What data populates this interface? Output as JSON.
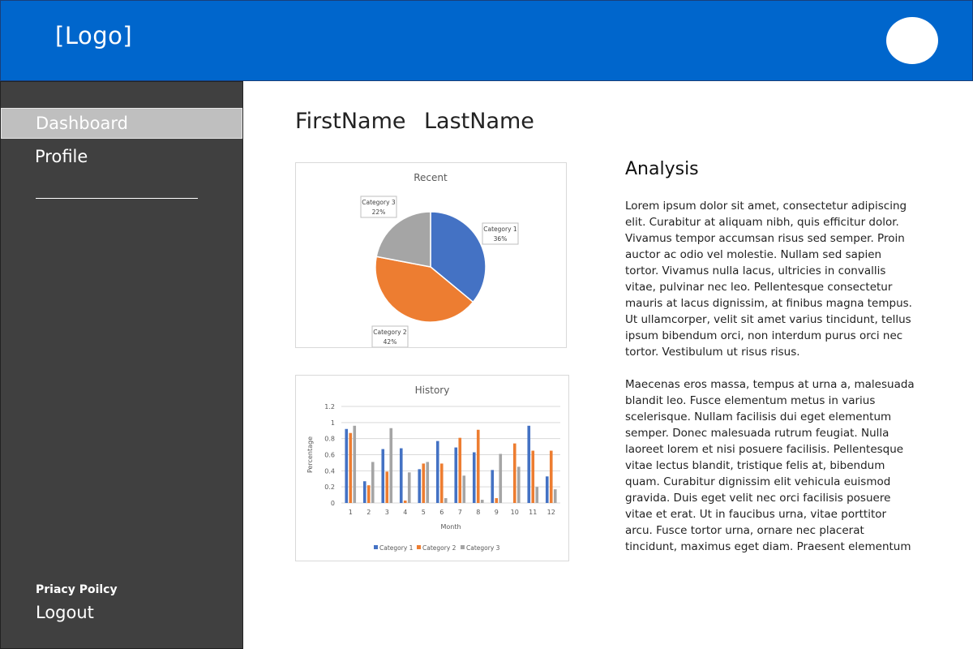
{
  "header": {
    "logo_text": "[Logo]",
    "color": "#0066cc"
  },
  "sidebar": {
    "items": [
      {
        "label": "Dashboard",
        "active": true
      },
      {
        "label": "Profile",
        "active": false
      }
    ],
    "privacy_label": "Priacy Poilcy",
    "logout_label": "Logout"
  },
  "user": {
    "first_name": "FirstName",
    "last_name": "LastName"
  },
  "analysis": {
    "title": "Analysis",
    "paragraphs": [
      "Lorem ipsum dolor sit amet, consectetur adipiscing elit. Curabitur at aliquam nibh, quis efficitur dolor. Vivamus tempor accumsan risus sed semper. Proin auctor ac odio vel molestie. Nullam sed sapien tortor. Vivamus nulla lacus, ultricies in convallis vitae, pulvinar nec leo. Pellentesque consectetur mauris at lacus dignissim, at finibus magna tempus. Ut ullamcorper, velit sit amet varius tincidunt, tellus ipsum bibendum orci, non interdum purus orci nec tortor. Vestibulum ut risus risus.",
      "Maecenas eros massa, tempus at urna a, malesuada blandit leo. Fusce elementum metus in varius scelerisque. Nullam facilisis dui eget elementum semper. Donec malesuada rutrum feugiat. Nulla laoreet lorem et nisi posuere facilisis. Pellentesque vitae lectus blandit, tristique felis at, bibendum quam. Curabitur dignissim elit vehicula euismod gravida. Duis eget velit nec orci facilisis posuere vitae et erat. Ut in faucibus urna, vitae porttitor arcu. Fusce tortor urna, ornare nec placerat tincidunt, maximus eget diam. Praesent elementum iaculis"
    ]
  },
  "chart_data": [
    {
      "type": "pie",
      "title": "Recent",
      "categories": [
        "Category 1",
        "Category 2",
        "Category 3"
      ],
      "values": [
        36,
        42,
        22
      ],
      "value_labels": [
        "36%",
        "42%",
        "22%"
      ],
      "colors": [
        "#4472c4",
        "#ed7d31",
        "#a5a5a5"
      ]
    },
    {
      "type": "bar",
      "title": "History",
      "xlabel": "Month",
      "ylabel": "Percentage",
      "categories": [
        "1",
        "2",
        "3",
        "4",
        "5",
        "6",
        "7",
        "8",
        "9",
        "10",
        "11",
        "12"
      ],
      "ylim": [
        0,
        1.2
      ],
      "yticks": [
        "0",
        "0.2",
        "0.4",
        "0.6",
        "0.8",
        "1",
        "1.2"
      ],
      "grid": true,
      "legend_position": "bottom",
      "series": [
        {
          "name": "Category 1",
          "color": "#4472c4",
          "values": [
            0.92,
            0.27,
            0.67,
            0.68,
            0.42,
            0.77,
            0.69,
            0.63,
            0.41,
            0.0,
            0.96,
            0.33
          ]
        },
        {
          "name": "Category 2",
          "color": "#ed7d31",
          "values": [
            0.87,
            0.22,
            0.39,
            0.03,
            0.49,
            0.49,
            0.81,
            0.91,
            0.06,
            0.74,
            0.65,
            0.65
          ]
        },
        {
          "name": "Category 3",
          "color": "#a5a5a5",
          "values": [
            0.96,
            0.51,
            0.93,
            0.38,
            0.51,
            0.06,
            0.34,
            0.04,
            0.61,
            0.45,
            0.2,
            0.17
          ]
        }
      ]
    }
  ]
}
